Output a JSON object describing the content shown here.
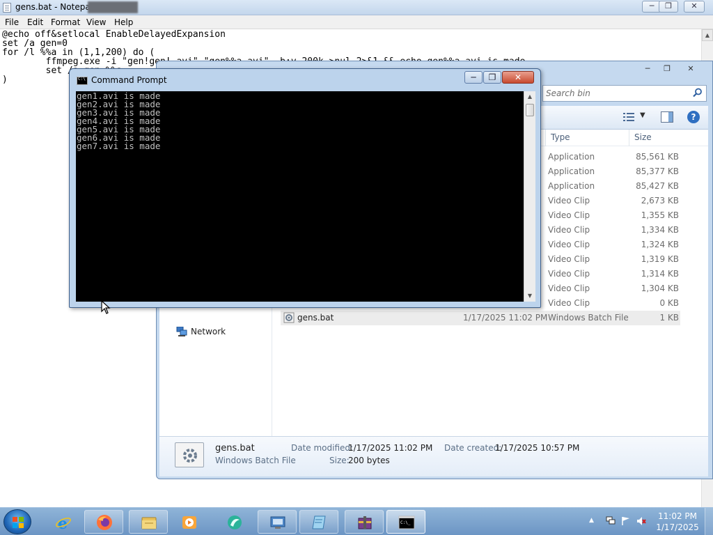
{
  "notepad": {
    "title": "gens.bat - Notepad",
    "menu": [
      "File",
      "Edit",
      "Format",
      "View",
      "Help"
    ],
    "lines": [
      "@echo off&setlocal EnableDelayedExpansion",
      "set /a gen=0",
      "for /l %%a in (1,1,200) do (",
      "        ffmpeg.exe -i \"gen!gen!.avi\" \"gen%%a.avi\" -b:v 200k >nul 2>&1 && echo gen%%a.avi is made",
      "        set /a gen=%%a",
      ")"
    ]
  },
  "explorer": {
    "search_placeholder": "Search bin",
    "columns": {
      "type": "Type",
      "size": "Size"
    },
    "nav": {
      "network": "Network"
    },
    "rows": [
      {
        "type": "Application",
        "size": "85,561 KB"
      },
      {
        "type": "Application",
        "size": "85,377 KB"
      },
      {
        "type": "Application",
        "size": "85,427 KB"
      },
      {
        "type": "Video Clip",
        "size": "2,673 KB"
      },
      {
        "type": "Video Clip",
        "size": "1,355 KB"
      },
      {
        "type": "Video Clip",
        "size": "1,334 KB"
      },
      {
        "type": "Video Clip",
        "size": "1,324 KB"
      },
      {
        "type": "Video Clip",
        "size": "1,319 KB"
      },
      {
        "type": "Video Clip",
        "size": "1,314 KB"
      },
      {
        "type": "Video Clip",
        "size": "1,304 KB"
      },
      {
        "type": "Video Clip",
        "size": "0 KB"
      }
    ],
    "selected_row": {
      "name": "gens.bat",
      "date": "1/17/2025 11:02 PM",
      "type": "Windows Batch File",
      "size": "1 KB"
    },
    "details": {
      "name": "gens.bat",
      "kind": "Windows Batch File",
      "modified_label": "Date modified:",
      "modified": "1/17/2025 11:02 PM",
      "created_label": "Date created:",
      "created": "1/17/2025 10:57 PM",
      "size_label": "Size:",
      "size": "200 bytes"
    }
  },
  "cmd": {
    "title": "Command Prompt",
    "output": [
      "gen1.avi is made",
      "gen2.avi is made",
      "gen3.avi is made",
      "gen4.avi is made",
      "gen5.avi is made",
      "gen6.avi is made",
      "gen7.avi is made"
    ]
  },
  "taskbar": {
    "apps": [
      "internet-explorer",
      "firefox",
      "file-explorer",
      "media-player",
      "browser-app",
      "control-panel",
      "notepad",
      "winrar",
      "command-prompt"
    ],
    "active_app": "command-prompt",
    "clock_time": "11:02 PM",
    "clock_date": "1/17/2025"
  }
}
